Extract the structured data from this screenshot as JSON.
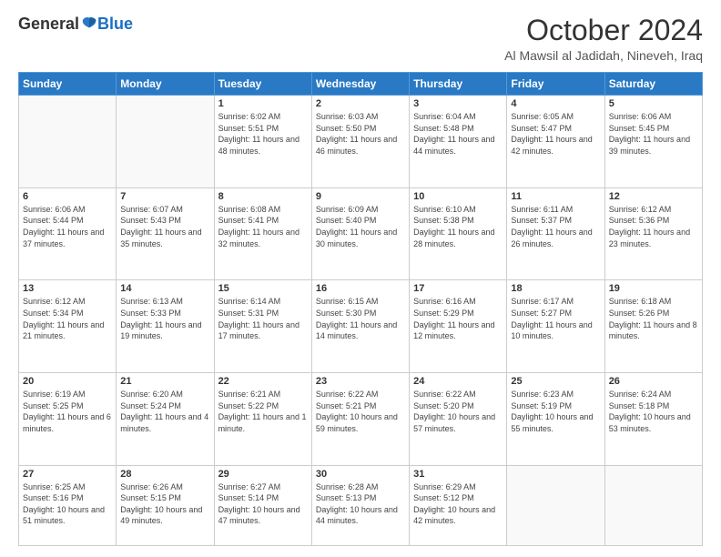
{
  "header": {
    "logo_general": "General",
    "logo_blue": "Blue",
    "month": "October 2024",
    "location": "Al Mawsil al Jadidah, Nineveh, Iraq"
  },
  "days_of_week": [
    "Sunday",
    "Monday",
    "Tuesday",
    "Wednesday",
    "Thursday",
    "Friday",
    "Saturday"
  ],
  "weeks": [
    [
      {
        "day": "",
        "info": ""
      },
      {
        "day": "",
        "info": ""
      },
      {
        "day": "1",
        "info": "Sunrise: 6:02 AM\nSunset: 5:51 PM\nDaylight: 11 hours and 48 minutes."
      },
      {
        "day": "2",
        "info": "Sunrise: 6:03 AM\nSunset: 5:50 PM\nDaylight: 11 hours and 46 minutes."
      },
      {
        "day": "3",
        "info": "Sunrise: 6:04 AM\nSunset: 5:48 PM\nDaylight: 11 hours and 44 minutes."
      },
      {
        "day": "4",
        "info": "Sunrise: 6:05 AM\nSunset: 5:47 PM\nDaylight: 11 hours and 42 minutes."
      },
      {
        "day": "5",
        "info": "Sunrise: 6:06 AM\nSunset: 5:45 PM\nDaylight: 11 hours and 39 minutes."
      }
    ],
    [
      {
        "day": "6",
        "info": "Sunrise: 6:06 AM\nSunset: 5:44 PM\nDaylight: 11 hours and 37 minutes."
      },
      {
        "day": "7",
        "info": "Sunrise: 6:07 AM\nSunset: 5:43 PM\nDaylight: 11 hours and 35 minutes."
      },
      {
        "day": "8",
        "info": "Sunrise: 6:08 AM\nSunset: 5:41 PM\nDaylight: 11 hours and 32 minutes."
      },
      {
        "day": "9",
        "info": "Sunrise: 6:09 AM\nSunset: 5:40 PM\nDaylight: 11 hours and 30 minutes."
      },
      {
        "day": "10",
        "info": "Sunrise: 6:10 AM\nSunset: 5:38 PM\nDaylight: 11 hours and 28 minutes."
      },
      {
        "day": "11",
        "info": "Sunrise: 6:11 AM\nSunset: 5:37 PM\nDaylight: 11 hours and 26 minutes."
      },
      {
        "day": "12",
        "info": "Sunrise: 6:12 AM\nSunset: 5:36 PM\nDaylight: 11 hours and 23 minutes."
      }
    ],
    [
      {
        "day": "13",
        "info": "Sunrise: 6:12 AM\nSunset: 5:34 PM\nDaylight: 11 hours and 21 minutes."
      },
      {
        "day": "14",
        "info": "Sunrise: 6:13 AM\nSunset: 5:33 PM\nDaylight: 11 hours and 19 minutes."
      },
      {
        "day": "15",
        "info": "Sunrise: 6:14 AM\nSunset: 5:31 PM\nDaylight: 11 hours and 17 minutes."
      },
      {
        "day": "16",
        "info": "Sunrise: 6:15 AM\nSunset: 5:30 PM\nDaylight: 11 hours and 14 minutes."
      },
      {
        "day": "17",
        "info": "Sunrise: 6:16 AM\nSunset: 5:29 PM\nDaylight: 11 hours and 12 minutes."
      },
      {
        "day": "18",
        "info": "Sunrise: 6:17 AM\nSunset: 5:27 PM\nDaylight: 11 hours and 10 minutes."
      },
      {
        "day": "19",
        "info": "Sunrise: 6:18 AM\nSunset: 5:26 PM\nDaylight: 11 hours and 8 minutes."
      }
    ],
    [
      {
        "day": "20",
        "info": "Sunrise: 6:19 AM\nSunset: 5:25 PM\nDaylight: 11 hours and 6 minutes."
      },
      {
        "day": "21",
        "info": "Sunrise: 6:20 AM\nSunset: 5:24 PM\nDaylight: 11 hours and 4 minutes."
      },
      {
        "day": "22",
        "info": "Sunrise: 6:21 AM\nSunset: 5:22 PM\nDaylight: 11 hours and 1 minute."
      },
      {
        "day": "23",
        "info": "Sunrise: 6:22 AM\nSunset: 5:21 PM\nDaylight: 10 hours and 59 minutes."
      },
      {
        "day": "24",
        "info": "Sunrise: 6:22 AM\nSunset: 5:20 PM\nDaylight: 10 hours and 57 minutes."
      },
      {
        "day": "25",
        "info": "Sunrise: 6:23 AM\nSunset: 5:19 PM\nDaylight: 10 hours and 55 minutes."
      },
      {
        "day": "26",
        "info": "Sunrise: 6:24 AM\nSunset: 5:18 PM\nDaylight: 10 hours and 53 minutes."
      }
    ],
    [
      {
        "day": "27",
        "info": "Sunrise: 6:25 AM\nSunset: 5:16 PM\nDaylight: 10 hours and 51 minutes."
      },
      {
        "day": "28",
        "info": "Sunrise: 6:26 AM\nSunset: 5:15 PM\nDaylight: 10 hours and 49 minutes."
      },
      {
        "day": "29",
        "info": "Sunrise: 6:27 AM\nSunset: 5:14 PM\nDaylight: 10 hours and 47 minutes."
      },
      {
        "day": "30",
        "info": "Sunrise: 6:28 AM\nSunset: 5:13 PM\nDaylight: 10 hours and 44 minutes."
      },
      {
        "day": "31",
        "info": "Sunrise: 6:29 AM\nSunset: 5:12 PM\nDaylight: 10 hours and 42 minutes."
      },
      {
        "day": "",
        "info": ""
      },
      {
        "day": "",
        "info": ""
      }
    ]
  ]
}
